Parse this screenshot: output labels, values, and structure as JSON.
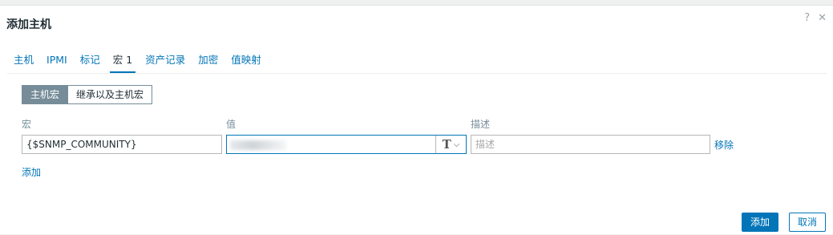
{
  "dialog": {
    "title": "添加主机",
    "help_icon": "?",
    "close_icon": "✕"
  },
  "tabs": [
    {
      "label": "主机",
      "active": false
    },
    {
      "label": "IPMI",
      "active": false
    },
    {
      "label": "标记",
      "active": false
    },
    {
      "label": "宏 1",
      "active": true
    },
    {
      "label": "资产记录",
      "active": false
    },
    {
      "label": "加密",
      "active": false
    },
    {
      "label": "值映射",
      "active": false
    }
  ],
  "macro_mode": {
    "host_macros": "主机宏",
    "inherited_macros": "继承以及主机宏"
  },
  "columns": {
    "macro": "宏",
    "value": "值",
    "description": "描述"
  },
  "row": {
    "macro": "{$SNMP_COMMUNITY}",
    "value_type_icon": "T",
    "description_placeholder": "描述",
    "remove_label": "移除"
  },
  "add_row_label": "添加",
  "footer": {
    "add_button": "添加",
    "cancel_button": "取消"
  }
}
